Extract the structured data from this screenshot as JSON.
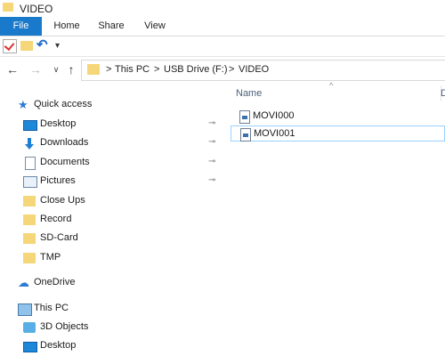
{
  "window": {
    "title": "VIDEO"
  },
  "ribbon": {
    "tabs": [
      "File",
      "Home",
      "Share",
      "View"
    ]
  },
  "quick_access_toolbar": {
    "icons": [
      "properties-icon",
      "new-folder-icon",
      "undo-icon",
      "customize-dropdown-icon"
    ],
    "dropdown_glyph": "▾"
  },
  "navigation": {
    "back_glyph": "←",
    "forward_glyph": "→",
    "recent_glyph": "∨",
    "up_glyph": "↑"
  },
  "address_bar": {
    "separator": ">",
    "breadcrumbs": [
      "This PC",
      "USB Drive (F:)",
      "VIDEO"
    ]
  },
  "nav_pane": {
    "quick_access": {
      "label": "Quick access",
      "items": [
        {
          "label": "Desktop",
          "icon": "desktop-icon",
          "pinned": true
        },
        {
          "label": "Downloads",
          "icon": "downloads-icon",
          "pinned": true
        },
        {
          "label": "Documents",
          "icon": "documents-icon",
          "pinned": true
        },
        {
          "label": "Pictures",
          "icon": "pictures-icon",
          "pinned": true
        },
        {
          "label": "Close Ups",
          "icon": "folder-icon",
          "pinned": false
        },
        {
          "label": "Record",
          "icon": "folder-icon",
          "pinned": false
        },
        {
          "label": "SD-Card",
          "icon": "folder-icon",
          "pinned": false
        },
        {
          "label": "TMP",
          "icon": "folder-icon",
          "pinned": false
        }
      ]
    },
    "onedrive": {
      "label": "OneDrive"
    },
    "this_pc": {
      "label": "This PC",
      "items": [
        {
          "label": "3D Objects",
          "icon": "3d-objects-icon"
        },
        {
          "label": "Desktop",
          "icon": "desktop-icon"
        }
      ]
    },
    "pin_glyph": "📌"
  },
  "content": {
    "columns": [
      "Name",
      "D"
    ],
    "sort_glyph": "^",
    "files": [
      {
        "name": "MOVI000",
        "selected": false
      },
      {
        "name": "MOVI001",
        "selected": true
      }
    ]
  },
  "colors": {
    "file_tab": "#1979ca",
    "folder": "#f5d678",
    "selection_border": "#99d1ff",
    "accent": "#2a7bd4"
  }
}
